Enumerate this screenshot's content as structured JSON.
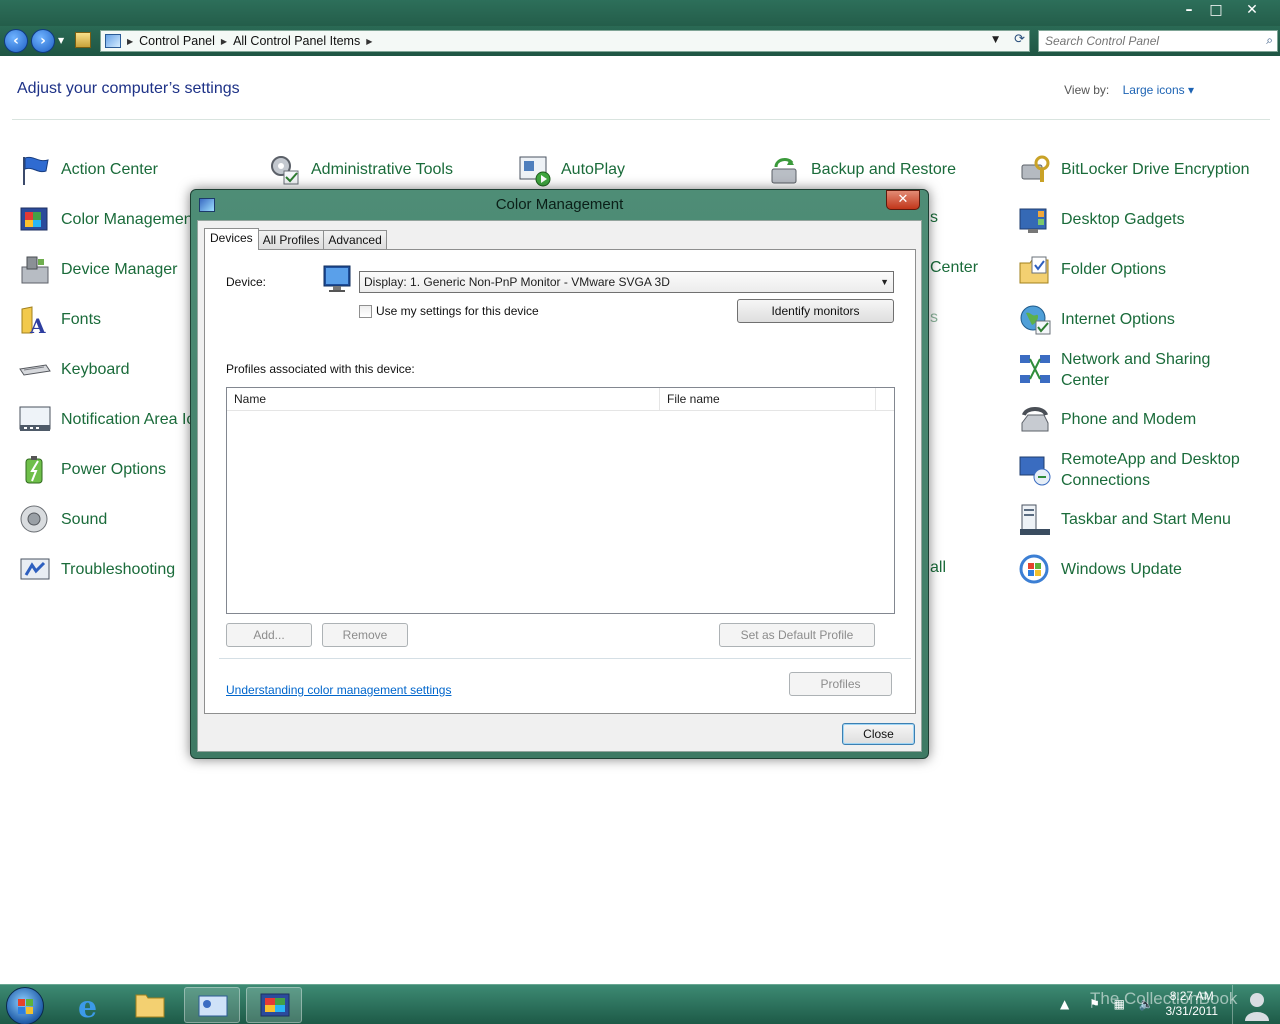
{
  "window": {
    "minimize_glyph": "–",
    "maximize_glyph": "□",
    "close_glyph": "✕"
  },
  "toolbar": {
    "breadcrumbs": [
      "Control Panel",
      "All Control Panel Items"
    ],
    "search_placeholder": "Search Control Panel"
  },
  "content": {
    "title": "Adjust your computer’s settings",
    "view_by_label": "View by:",
    "view_by_value": "Large icons ▾",
    "items": [
      {
        "label": "Action Center",
        "icon": "flag-icon"
      },
      {
        "label": "Administrative Tools",
        "icon": "gears-icon"
      },
      {
        "label": "AutoPlay",
        "icon": "autoplay-icon"
      },
      {
        "label": "Backup and Restore",
        "icon": "backup-icon"
      },
      {
        "label": "BitLocker Drive Encryption",
        "icon": "key-lock-icon"
      },
      {
        "label": "Color Management",
        "icon": "color-icon"
      },
      {
        "label": "Desktop Gadgets",
        "icon": "gadgets-icon"
      },
      {
        "label": "Device Manager",
        "icon": "device-manager-icon"
      },
      {
        "label": "Folder Options",
        "icon": "folder-options-icon"
      },
      {
        "label": "Fonts",
        "icon": "fonts-icon"
      },
      {
        "label": "Internet Options",
        "icon": "globe-icon"
      },
      {
        "label": "Keyboard",
        "icon": "keyboard-icon"
      },
      {
        "label": "Network and Sharing Center",
        "icon": "network-icon"
      },
      {
        "label": "Notification Area Icons",
        "icon": "notification-icon"
      },
      {
        "label": "Phone and Modem",
        "icon": "phone-icon"
      },
      {
        "label": "Power Options",
        "icon": "battery-icon"
      },
      {
        "label": "RemoteApp and Desktop Connections",
        "icon": "remoteapp-icon"
      },
      {
        "label": "Sound",
        "icon": "speaker-icon"
      },
      {
        "label": "Taskbar and Start Menu",
        "icon": "taskbar-icon"
      },
      {
        "label": "Troubleshooting",
        "icon": "troubleshoot-icon"
      },
      {
        "label": "Windows Update",
        "icon": "windows-update-icon"
      }
    ],
    "peek_fragments": [
      "s",
      "Center",
      "s",
      "all"
    ]
  },
  "dialog": {
    "title": "Color Management",
    "close_glyph": "✕",
    "tabs": [
      "Devices",
      "All Profiles",
      "Advanced"
    ],
    "device_label": "Device:",
    "device_value": "Display: 1. Generic Non-PnP Monitor - VMware SVGA 3D",
    "use_settings_label": "Use my settings for this device",
    "identify_button": "Identify monitors",
    "profiles_label": "Profiles associated with this device:",
    "columns": [
      "Name",
      "File name"
    ],
    "add_button": "Add...",
    "remove_button": "Remove",
    "set_default_button": "Set as Default Profile",
    "help_link": "Understanding color management settings",
    "profiles_button": "Profiles",
    "close_button": "Close"
  },
  "taskbar": {
    "time": "8:27 AM",
    "date": "3/31/2011",
    "watermark": "The CollectionBook"
  },
  "colors": {
    "chrome": "#2a6a55",
    "item_text": "#1a6b3a",
    "title_text": "#1e3287",
    "link": "#0066cc"
  }
}
